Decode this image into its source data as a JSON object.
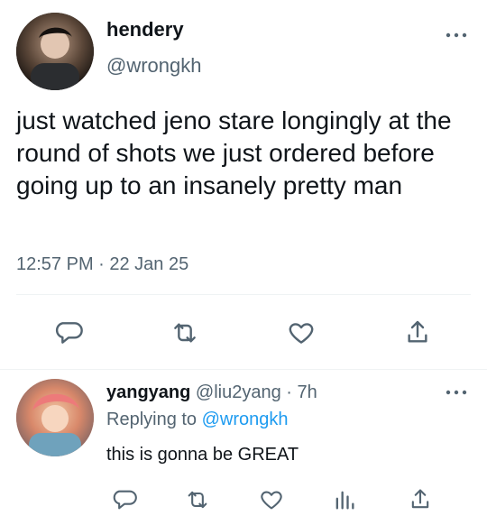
{
  "main_tweet": {
    "author_name": "hendery",
    "author_handle": "@wrongkh",
    "text": "just watched jeno stare longingly at the round of shots we just ordered before going up to an insanely pretty man",
    "timestamp": "12:57 PM · 22 Jan 25",
    "actions": [
      "reply-icon",
      "retweet-icon",
      "like-icon",
      "share-icon"
    ]
  },
  "reply": {
    "author_name": "yangyang",
    "author_handle": "@liu2yang",
    "dot": "·",
    "age": "7h",
    "replying_to_prefix": "Replying to",
    "replying_to_handle": "@wrongkh",
    "text": "this is gonna be GREAT",
    "actions": [
      "reply-icon",
      "retweet-icon",
      "like-icon",
      "analytics-icon",
      "share-icon"
    ]
  },
  "colors": {
    "text": "#0f1419",
    "muted": "#536471",
    "link": "#1d9bf0",
    "divider": "#eff3f4"
  }
}
